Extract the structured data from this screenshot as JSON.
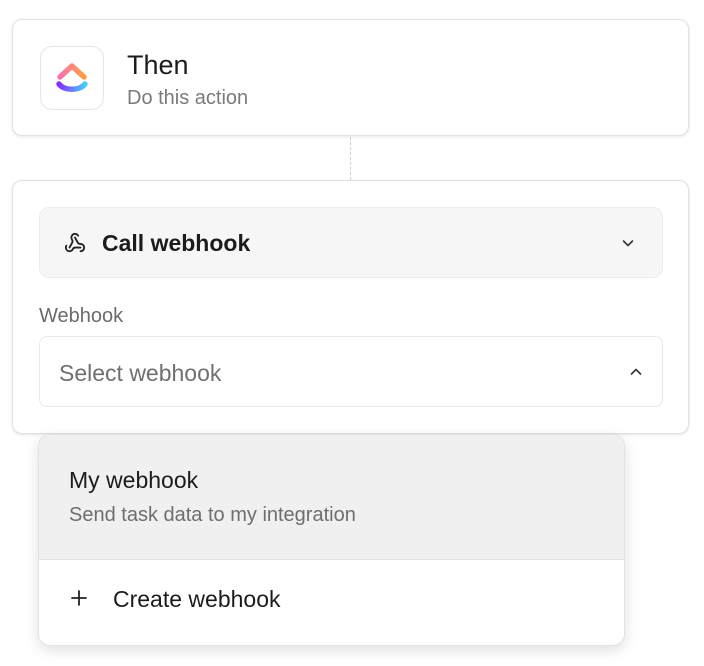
{
  "trigger": {
    "app_icon": "clickup-logo-icon",
    "title": "Then",
    "subtitle": "Do this action"
  },
  "action": {
    "icon": "webhook-icon",
    "label": "Call webhook",
    "chevron": "chevron-down-icon"
  },
  "webhook_field": {
    "label": "Webhook",
    "placeholder": "Select webhook",
    "chevron": "chevron-up-icon",
    "expanded": true
  },
  "dropdown": {
    "options": [
      {
        "title": "My webhook",
        "description": "Send task data to my integration",
        "highlighted": true
      }
    ],
    "create": {
      "icon": "plus-icon",
      "label": "Create webhook"
    }
  },
  "colors": {
    "logo_gradient": [
      "#fd71af",
      "#ff9e4a",
      "#8930fd",
      "#49ccf9"
    ],
    "highlight_bg": "#f0f0f0"
  }
}
